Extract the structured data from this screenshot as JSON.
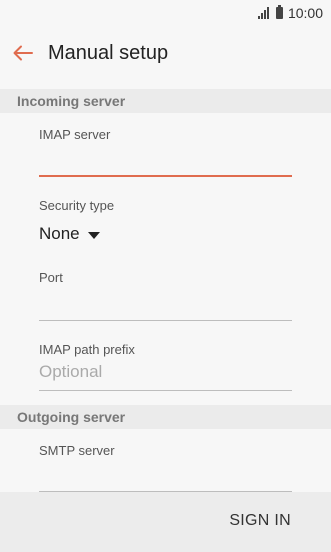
{
  "status_bar": {
    "time": "10:00"
  },
  "header": {
    "title": "Manual setup"
  },
  "incoming": {
    "section_title": "Incoming server",
    "imap_server_label": "IMAP server",
    "imap_server_value": "",
    "security_type_label": "Security type",
    "security_type_value": "None",
    "port_label": "Port",
    "port_value": "",
    "path_prefix_label": "IMAP path prefix",
    "path_prefix_placeholder": "Optional"
  },
  "outgoing": {
    "section_title": "Outgoing server",
    "smtp_server_label": "SMTP server",
    "smtp_server_value": ""
  },
  "footer": {
    "sign_in_label": "SIGN IN"
  },
  "colors": {
    "accent": "#e06c4f",
    "header_bg": "#ebebeb",
    "background": "#f7f7f7"
  }
}
